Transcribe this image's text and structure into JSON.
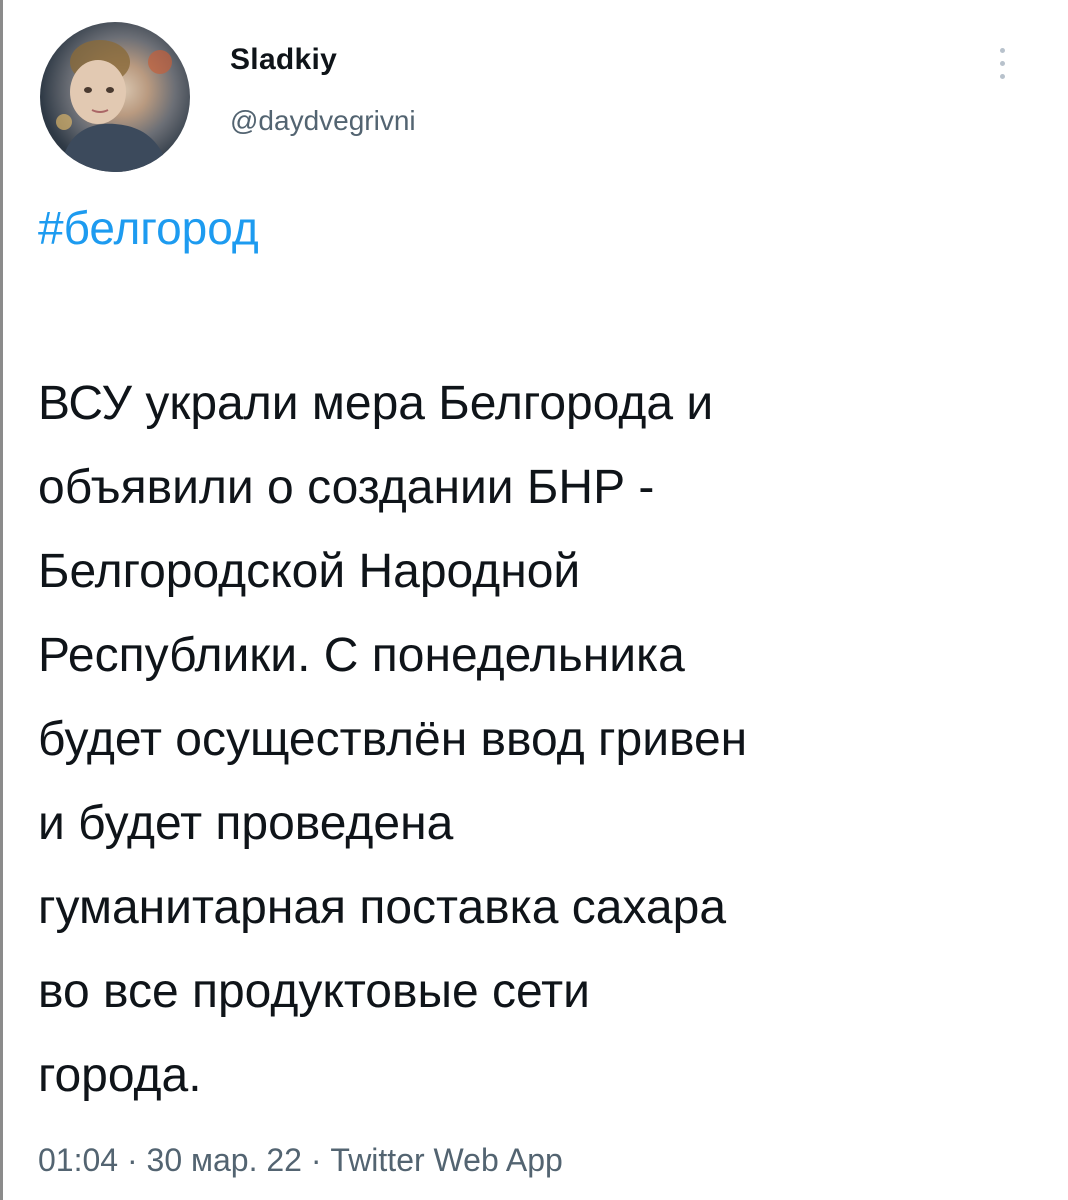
{
  "author": {
    "display_name": "Sladkiy",
    "handle": "@daydvegrivni"
  },
  "tweet": {
    "hashtag": "#белгород",
    "lines": [
      "ВСУ украли мера Белгорода и",
      "объявили о создании БНР -",
      "Белгородской Народной",
      "Республики. С понедельника",
      "будет осуществлён ввод гривен",
      "и будет проведена",
      "гуманитарная поставка сахара",
      "во все продуктовые сети",
      "города."
    ]
  },
  "footer": {
    "time": "01:04",
    "separator": "·",
    "date": "30 мар. 22",
    "source": "Twitter Web App"
  },
  "icons": {
    "more": "more-vertical-icon"
  },
  "colors": {
    "hashtag": "#1d9bf0",
    "text": "#0f1419",
    "secondary": "#536471"
  }
}
